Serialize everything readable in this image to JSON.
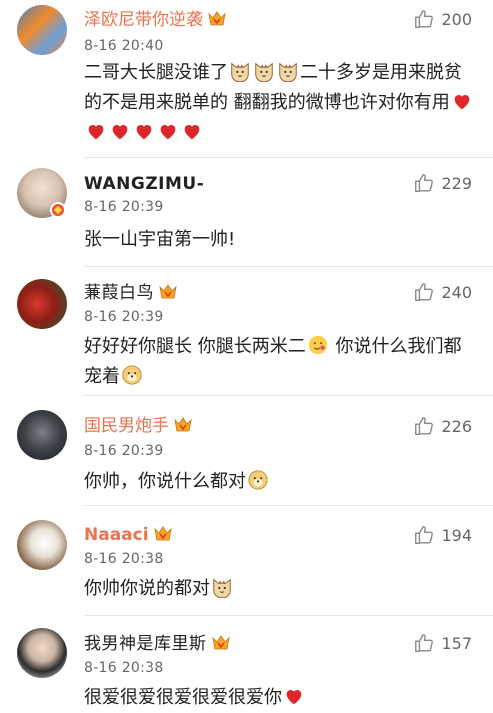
{
  "comments": [
    {
      "name": "泽欧尼带你逆袭",
      "time": "8-16 20:40",
      "likes": "200",
      "text_parts": [
        "二哥大长腿没谁了",
        "二十多岁是用来脱贫的不是用来脱单的  翻翻我的微博也许对你有用"
      ],
      "emoji": [
        "cat-emoji",
        "heart-emoji"
      ]
    },
    {
      "name": "WANGZIMU-",
      "time": "8-16 20:39",
      "likes": "229",
      "text": "张一山宇宙第一帅!"
    },
    {
      "name": "蒹葭白鸟",
      "time": "8-16 20:39",
      "likes": "240",
      "text_parts": [
        "好好好你腿长 你腿长两米二",
        "你说什么我们都宠着"
      ],
      "emoji": [
        "smile-emoji",
        "doge-emoji"
      ]
    },
    {
      "name": "国民男炮手",
      "time": "8-16 20:39",
      "likes": "226",
      "text": "你帅，你说什么都对",
      "emoji": [
        "doge-emoji"
      ]
    },
    {
      "name": "Naaaci",
      "time": "8-16 20:38",
      "likes": "194",
      "text": "你帅你说的都对",
      "emoji": [
        "cat-emoji"
      ]
    },
    {
      "name": "我男神是库里斯",
      "time": "8-16 20:38",
      "likes": "157",
      "text": "很爱很爱很爱很爱很爱你",
      "emoji": [
        "heart-emoji"
      ]
    }
  ],
  "colors": {
    "name_orange": "#eb7350",
    "heart": "#e0262b"
  }
}
